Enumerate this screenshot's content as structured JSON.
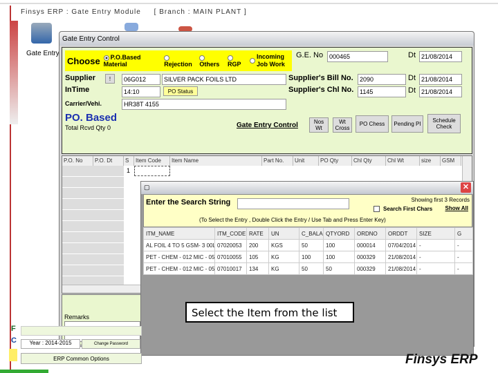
{
  "window": {
    "title": "Finsys ERP : Gate Entry Module",
    "branch": "[ Branch : MAIN PLANT ]",
    "toolbar_label": "Gate Entry"
  },
  "dialog": {
    "title": "Gate Entry Control",
    "choose": {
      "label": "Choose",
      "options": [
        "P.O.Based Material",
        "Rejection",
        "Others",
        "RGP",
        "Incoming Job Work"
      ],
      "selected": "P.O.Based Material"
    },
    "ge_no_label": "G.E. No",
    "ge_no": "000465",
    "dt_label": "Dt",
    "ge_date": "21/08/2014",
    "supplier_label": "Supplier",
    "supplier_btn": "!",
    "supplier_code": "06G012",
    "supplier_name": "SILVER PACK FOILS LTD",
    "bill_label": "Supplier's Bill No.",
    "bill_no": "2090",
    "bill_date": "21/08/2014",
    "intime_label": "InTime",
    "intime": "14:10",
    "po_status_btn": "PO Status",
    "chl_label": "Supplier's Chl No.",
    "chl_no": "1145",
    "chl_date": "21/08/2014",
    "carrier_label": "Carrier/Vehi.",
    "carrier": "HR38T 4155",
    "mode_title": "PO. Based",
    "total_label": "Total Rcvd Qty 0",
    "gate_entry_link": "Gate Entry Control",
    "buttons": [
      "Nos Wt",
      "Wt Cross",
      "PO Chess",
      "Pending PI",
      "Schedule Check"
    ],
    "grid_columns": [
      "P.O. No",
      "P.O. Dt",
      "S",
      "Item Code",
      "Item Name",
      "Part No.",
      "Unit",
      "PO Qty",
      "Chl Qty",
      "Chl Wt",
      "size",
      "GSM"
    ],
    "grid_first_row": "1",
    "remarks_label": "Remarks"
  },
  "popup": {
    "search_label": "Enter the Search String",
    "search_value": "",
    "showing": "Showing first 3 Records",
    "first_chars": "Search First Chars",
    "show_all": "Show All",
    "hint": "(To Select the Entry , Double Click the Entry / Use Tab and Press Enter Key)",
    "columns": [
      "ITM_NAME",
      "ITM_CODE",
      "RATE",
      "UN",
      "C_BALAN",
      "QTYORD",
      "ORDNO",
      "ORDDT",
      "SIZE",
      "G"
    ],
    "rows": [
      [
        "AL FOIL 4 TO 5 GSM- 3 00L",
        "07020053",
        "200",
        "KGS",
        "50",
        "100",
        "000014",
        "07/04/2014",
        "-",
        "-"
      ],
      [
        "PET - CHEM - 012 MIC - 050",
        "07010055",
        "105",
        "KG",
        "100",
        "100",
        "000329",
        "21/08/2014",
        "-",
        "-"
      ],
      [
        "PET - CHEM - 012 MIC - 057",
        "07010017",
        "134",
        "KG",
        "50",
        "50",
        "000329",
        "21/08/2014",
        "-",
        "-"
      ]
    ]
  },
  "annotation": "Select the Item from the list",
  "left_panel": {
    "year": "Year : 2014-2015",
    "change_password": "Change Password",
    "common_options": "ERP Common Options"
  },
  "brand": "Finsys ERP"
}
